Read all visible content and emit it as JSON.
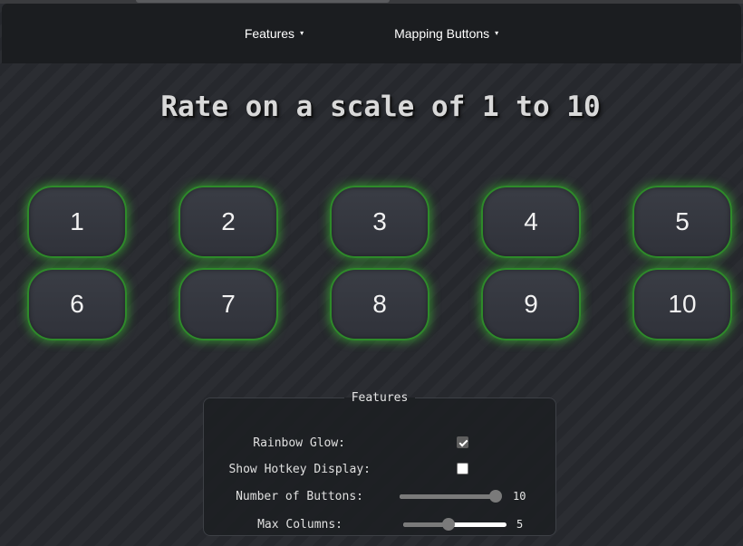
{
  "navbar": {
    "items": [
      {
        "label": "Features",
        "caret": "▾"
      },
      {
        "label": "Mapping Buttons",
        "caret": "▾"
      }
    ]
  },
  "title": "Rate on a scale of 1 to 10",
  "buttons": [
    "1",
    "2",
    "3",
    "4",
    "5",
    "6",
    "7",
    "8",
    "9",
    "10"
  ],
  "features": {
    "legend": "Features",
    "rainbow_glow": {
      "label": "Rainbow Glow:",
      "checked": true
    },
    "show_hotkey": {
      "label": "Show Hotkey Display:",
      "checked": false
    },
    "num_buttons": {
      "label": "Number of Buttons:",
      "value": "10",
      "fraction": 1.0
    },
    "max_columns": {
      "label": "Max Columns:",
      "value": "5",
      "fraction": 0.44
    }
  },
  "colors": {
    "glow": "#3cc832",
    "border": "#2e8a2a",
    "navbar_bg": "#1b1d20"
  }
}
